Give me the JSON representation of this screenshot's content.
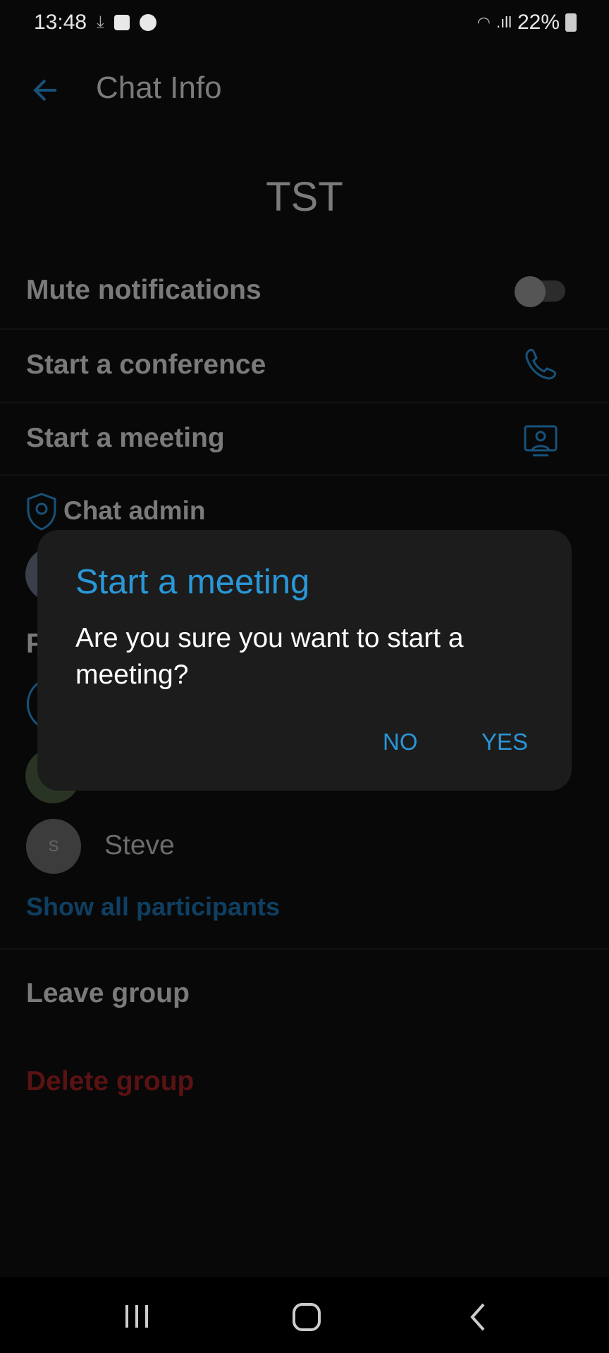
{
  "status_bar": {
    "time": "13:48",
    "battery": "22%",
    "icons": [
      "download-icon",
      "image-icon",
      "g-icon",
      "wifi-icon",
      "signal-icon",
      "battery-charging-icon"
    ]
  },
  "header": {
    "title": "Chat Info",
    "back_icon": "arrow-left-icon"
  },
  "group_name": "TST",
  "settings": {
    "mute_label": "Mute notifications",
    "mute_on": false,
    "conference_label": "Start a conference",
    "meeting_label": "Start a meeting"
  },
  "admin_section": {
    "label": "Chat admin"
  },
  "participants": {
    "partial_header": "P",
    "items": [
      {
        "initial": "S",
        "name": "Steve"
      }
    ],
    "show_all": "Show all participants"
  },
  "actions": {
    "leave": "Leave group",
    "delete": "Delete group"
  },
  "dialog": {
    "title": "Start a meeting",
    "message": "Are you sure you want to start a meeting?",
    "no": "NO",
    "yes": "YES"
  },
  "colors": {
    "accent": "#2a97d8",
    "danger": "#6a1414"
  }
}
